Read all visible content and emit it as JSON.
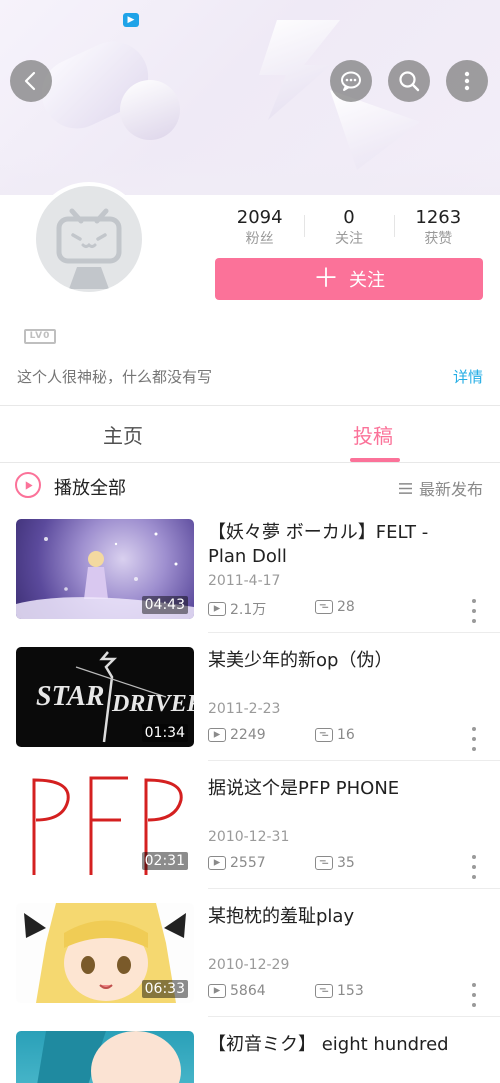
{
  "header": {
    "back_icon": "back-arrow-icon",
    "actions": [
      "chat-bubble-icon",
      "search-icon",
      "more-vertical-icon"
    ]
  },
  "profile": {
    "stats": [
      {
        "num": "2094",
        "label": "粉丝"
      },
      {
        "num": "0",
        "label": "关注"
      },
      {
        "num": "1263",
        "label": "获赞"
      }
    ],
    "follow_label": "关注",
    "level": "LV0",
    "signature": "这个人很神秘，什么都没有写",
    "detail_link": "详情"
  },
  "tabs": [
    {
      "label": "主页",
      "active": false
    },
    {
      "label": "投稿",
      "active": true
    }
  ],
  "list_header": {
    "play_all": "播放全部",
    "sort": "最新发布"
  },
  "videos": [
    {
      "title": "【妖々夢 ボーカル】FELT - Plan Doll",
      "date": "2011-4-17",
      "plays": "2.1万",
      "danmaku": "28",
      "duration": "04:43"
    },
    {
      "title": "某美少年的新op（伪）",
      "date": "2011-2-23",
      "plays": "2249",
      "danmaku": "16",
      "duration": "01:34"
    },
    {
      "title": "据说这个是PFP PHONE",
      "date": "2010-12-31",
      "plays": "2557",
      "danmaku": "35",
      "duration": "02:31"
    },
    {
      "title": "某抱枕的羞耻play",
      "date": "2010-12-29",
      "plays": "5864",
      "danmaku": "153",
      "duration": "06:33"
    },
    {
      "title": "【初音ミク】 eight hundred",
      "date": "",
      "plays": "",
      "danmaku": "",
      "duration": ""
    }
  ],
  "colors": {
    "accent": "#fb7299",
    "link": "#23ade5"
  }
}
